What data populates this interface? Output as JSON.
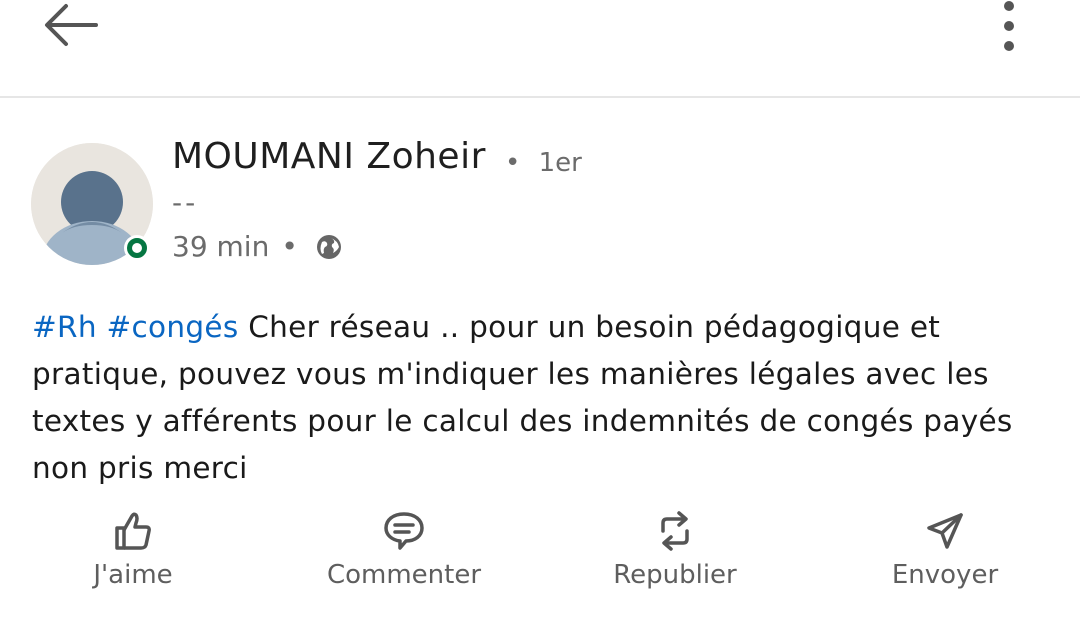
{
  "header": {
    "back_icon": "arrow-left-icon",
    "more_icon": "more-vertical-icon"
  },
  "post": {
    "author": {
      "name": "MOUMANI Zoheir",
      "degree": "1er",
      "headline": "--",
      "presence_color": "#057642"
    },
    "meta": {
      "time": "39 min",
      "separator": "•",
      "visibility_icon": "globe-icon"
    },
    "hashtags": [
      "#Rh",
      "#congés"
    ],
    "body": "Cher réseau .. pour un besoin pédagogique et pratique, pouvez vous m'indiquer les manières légales avec les textes y afférents pour le calcul des indemnités de congés payés non pris merci"
  },
  "actions": [
    {
      "label": "J'aime",
      "icon": "thumbs-up-icon"
    },
    {
      "label": "Commenter",
      "icon": "comment-icon"
    },
    {
      "label": "Republier",
      "icon": "repost-icon"
    },
    {
      "label": "Envoyer",
      "icon": "send-icon"
    }
  ],
  "colors": {
    "hashtag": "#0a66c2",
    "text": "#1a1a1a",
    "secondary": "#6b6b6b"
  }
}
